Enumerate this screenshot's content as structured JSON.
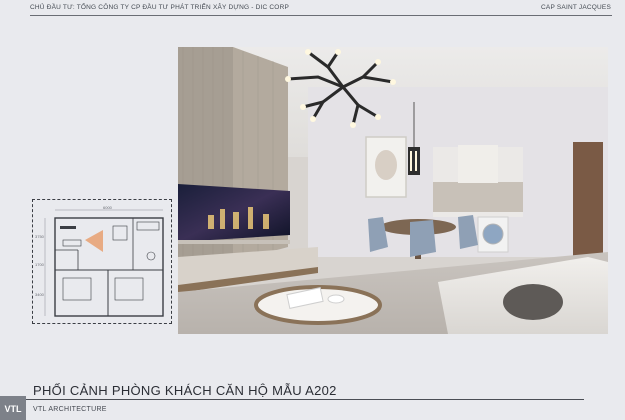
{
  "header": {
    "investor": "CHỦ ĐẦU TƯ: TỔNG CÔNG TY CP ĐẦU TƯ PHÁT TRIỂN XÂY DỰNG - DIC CORP",
    "project": "CAP SAINT JACQUES"
  },
  "plan": {
    "dim_width": "6000",
    "dim_left_top": "3750",
    "dim_left_mid": "1700",
    "dim_left_bottom": "3400"
  },
  "footer": {
    "title": "PHỐI CẢNH PHÒNG KHÁCH CĂN HỘ MẪU A202",
    "firm": "VTL ARCHITECTURE",
    "logo_text": "VTL"
  },
  "colors": {
    "background": "#e9eaee",
    "text": "#2b2e35",
    "logo_bg": "#7d8189"
  }
}
